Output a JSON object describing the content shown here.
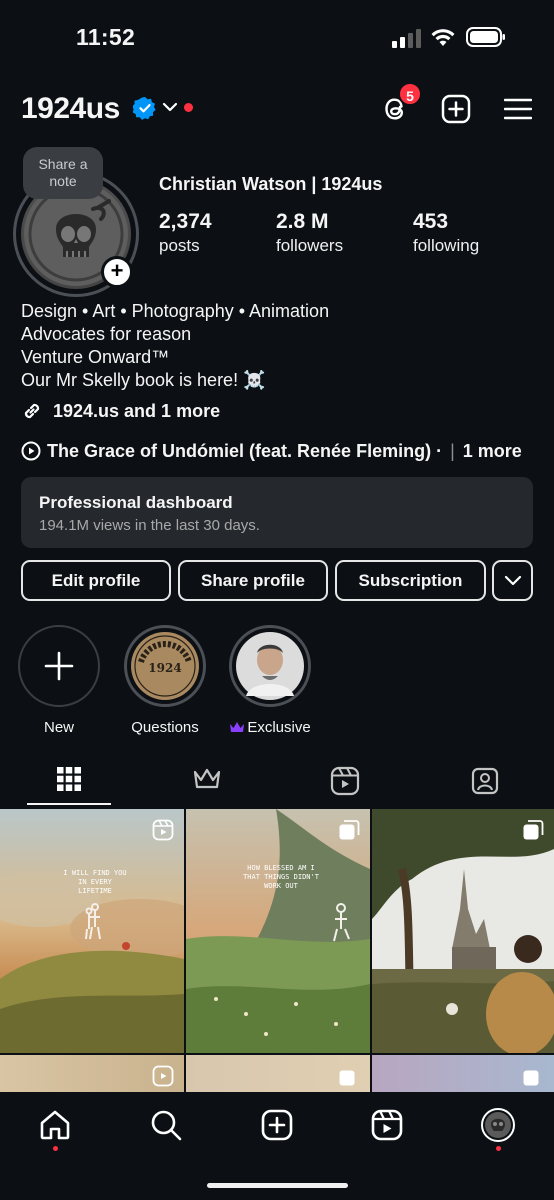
{
  "status_bar": {
    "time": "11:52"
  },
  "header": {
    "username": "1924us",
    "threads_badge": "5"
  },
  "profile": {
    "note": "Share a note",
    "full_name": "Christian Watson | 1924us",
    "stats": [
      {
        "num": "2,374",
        "label": "posts"
      },
      {
        "num": "2.8 M",
        "label": "followers"
      },
      {
        "num": "453",
        "label": "following"
      }
    ],
    "bio": [
      "Design • Art • Photography • Animation",
      "Advocates for reason",
      "Venture Onward™",
      "Our Mr Skelly book is here! ☠️"
    ],
    "link": "1924.us and 1 more",
    "music": {
      "title": "The Grace of Undómiel (feat. Renée Fleming) ·",
      "more": "1 more"
    }
  },
  "dashboard": {
    "title": "Professional dashboard",
    "subtitle": "194.1M views in the last 30 days."
  },
  "buttons": {
    "edit": "Edit profile",
    "share": "Share profile",
    "subscription": "Subscription"
  },
  "highlights": [
    {
      "label": "New"
    },
    {
      "label": "Questions"
    },
    {
      "label": "Exclusive"
    }
  ],
  "posts": [
    {
      "caption": "I WILL FIND YOU IN EVERY LIFETIME",
      "type": "reel"
    },
    {
      "caption": "HOW BLESSED AM I THAT THINGS DIDN'T WORK OUT",
      "type": "carousel"
    },
    {
      "caption": "",
      "type": "carousel"
    }
  ],
  "colors": {
    "background": "#0c1014",
    "accent_red": "#ff3040",
    "verified_blue": "#0095f6",
    "exclusive_purple": "#8a3ffc"
  }
}
